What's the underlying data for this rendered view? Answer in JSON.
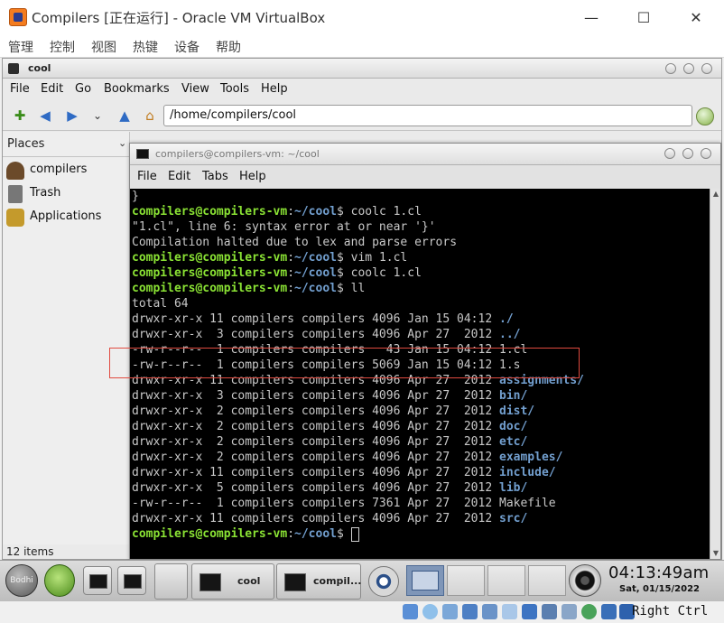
{
  "vbox": {
    "title": "Compilers [正在运行] - Oracle VM VirtualBox",
    "menu": [
      "管理",
      "控制",
      "视图",
      "热键",
      "设备",
      "帮助"
    ],
    "host_key": "Right Ctrl"
  },
  "file_manager": {
    "title": "cool",
    "menu": [
      "File",
      "Edit",
      "Go",
      "Bookmarks",
      "View",
      "Tools",
      "Help"
    ],
    "location": "/home/compilers/cool",
    "places_label": "Places",
    "places": [
      "compilers",
      "Trash",
      "Applications"
    ],
    "status": "12 items"
  },
  "terminal": {
    "title": "compilers@compilers-vm: ~/cool",
    "menu": [
      "File",
      "Edit",
      "Tabs",
      "Help"
    ],
    "prompt_user": "compilers@compilers-vm",
    "prompt_path": "~/cool",
    "lines": {
      "l0": "}",
      "l1_cmd": " coolc 1.cl",
      "l2": "\"1.cl\", line 6: syntax error at or near '}'",
      "l3": "Compilation halted due to lex and parse errors",
      "l4_cmd": " vim 1.cl",
      "l5_cmd": " coolc 1.cl",
      "l6_cmd": " ll",
      "l7": "total 64",
      "ls": [
        {
          "meta": "drwxr-xr-x 11 compilers compilers 4096 Jan 15 04:12 ",
          "name": "./",
          "dir": true
        },
        {
          "meta": "drwxr-xr-x  3 compilers compilers 4096 Apr 27  2012 ",
          "name": "../",
          "dir": true
        },
        {
          "meta": "-rw-r--r--  1 compilers compilers   43 Jan 15 04:12 ",
          "name": "1.cl",
          "dir": false
        },
        {
          "meta": "-rw-r--r--  1 compilers compilers 5069 Jan 15 04:12 ",
          "name": "1.s",
          "dir": false
        },
        {
          "meta": "drwxr-xr-x 11 compilers compilers 4096 Apr 27  2012 ",
          "name": "assignments/",
          "dir": true
        },
        {
          "meta": "drwxr-xr-x  3 compilers compilers 4096 Apr 27  2012 ",
          "name": "bin/",
          "dir": true
        },
        {
          "meta": "drwxr-xr-x  2 compilers compilers 4096 Apr 27  2012 ",
          "name": "dist/",
          "dir": true
        },
        {
          "meta": "drwxr-xr-x  2 compilers compilers 4096 Apr 27  2012 ",
          "name": "doc/",
          "dir": true
        },
        {
          "meta": "drwxr-xr-x  2 compilers compilers 4096 Apr 27  2012 ",
          "name": "etc/",
          "dir": true
        },
        {
          "meta": "drwxr-xr-x  2 compilers compilers 4096 Apr 27  2012 ",
          "name": "examples/",
          "dir": true
        },
        {
          "meta": "drwxr-xr-x 11 compilers compilers 4096 Apr 27  2012 ",
          "name": "include/",
          "dir": true
        },
        {
          "meta": "drwxr-xr-x  5 compilers compilers 4096 Apr 27  2012 ",
          "name": "lib/",
          "dir": true
        },
        {
          "meta": "-rw-r--r--  1 compilers compilers 7361 Apr 27  2012 ",
          "name": "Makefile",
          "dir": false
        },
        {
          "meta": "drwxr-xr-x 11 compilers compilers 4096 Apr 27  2012 ",
          "name": "src/",
          "dir": true
        }
      ]
    }
  },
  "taskbar": {
    "bodhi_label": "Bodhi",
    "tasks": [
      "cool",
      "compil..."
    ],
    "clock_time": "04:13:49am",
    "clock_date": "Sat, 01/15/2022"
  },
  "colors": {
    "prompt_user": "#8ae234",
    "prompt_path": "#729fcf",
    "highlight_box": "#e04a3f"
  }
}
